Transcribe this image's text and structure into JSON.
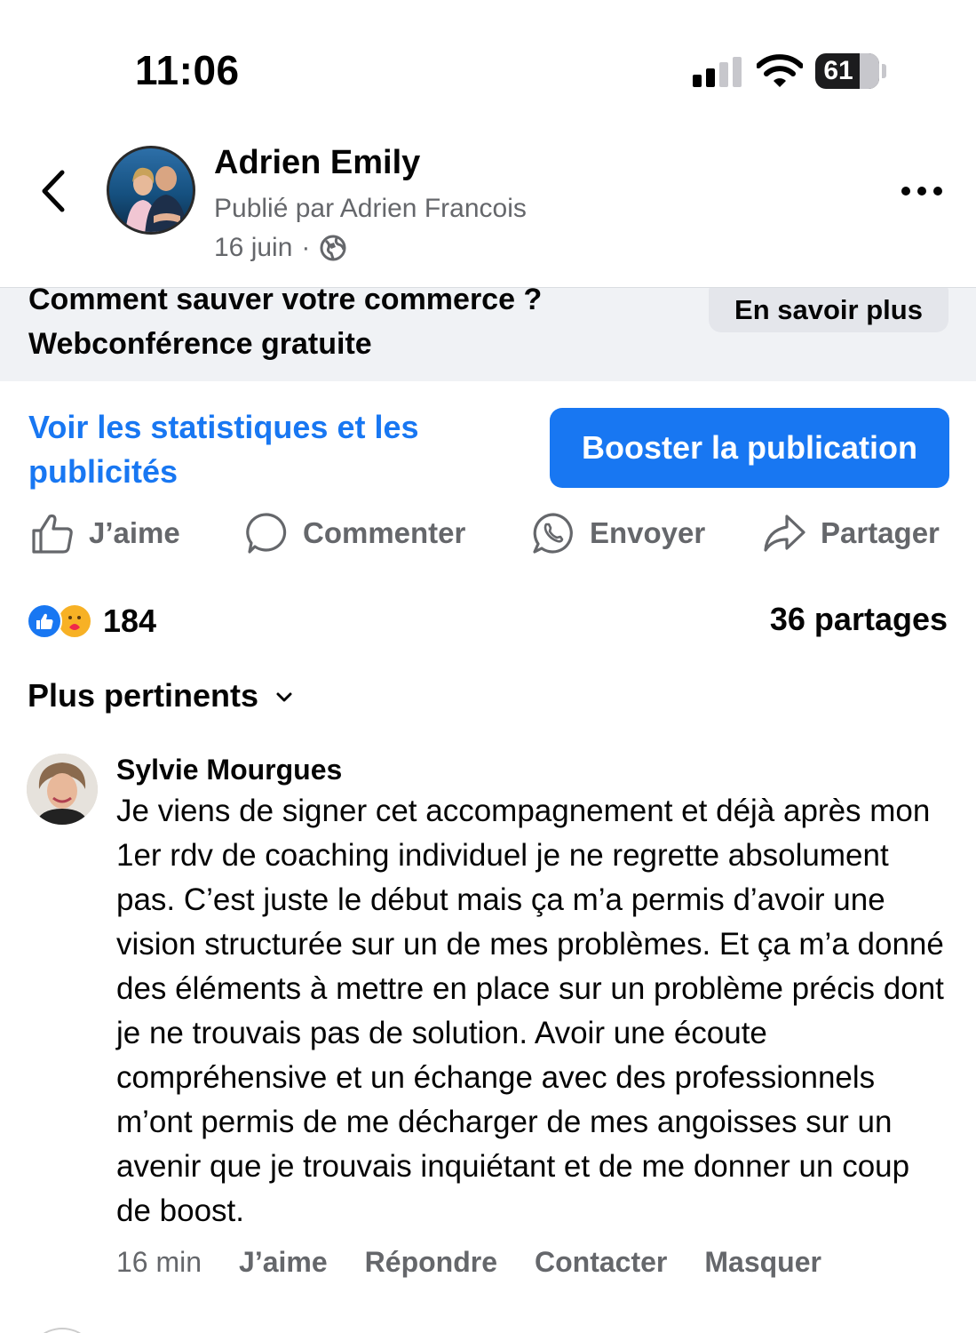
{
  "status_bar": {
    "time": "11:06",
    "battery": "61",
    "battery_level": 0.61
  },
  "post": {
    "author": "Adrien Emily",
    "posted_by": "Publié par Adrien Francois",
    "date": "16 juin",
    "separator": "·",
    "privacy_icon": "globe-icon"
  },
  "link_card": {
    "title_line_1": "Comment sauver votre commerce ?",
    "title_line_2": "Webconférence gratuite",
    "cta": "En savoir plus"
  },
  "stats_link": "Voir les statistiques et les publicités",
  "boost_button": "Booster la publication",
  "actions": {
    "like": "J’aime",
    "comment": "Commenter",
    "send": "Envoyer",
    "share": "Partager"
  },
  "reactions": {
    "count": "184",
    "shares": "36 partages",
    "types": [
      "like",
      "care"
    ]
  },
  "sort": {
    "label": "Plus pertinents"
  },
  "comment": {
    "author": "Sylvie Mourgues",
    "text": "Je viens de signer cet accompagnement et déjà après mon 1er rdv de coaching individuel je ne regrette absolument pas. C’est juste le début mais ça m’a permis d’avoir une vision structurée sur un de mes problèmes. Et ça m’a donné des éléments à mettre en place sur un problème précis dont je ne trouvais pas de solution. Avoir une écoute compréhensive et un échange avec des professionnels m’ont permis de me décharger de mes angoisses sur un avenir que je trouvais inquiétant et de me donner un coup de boost.",
    "time": "16 min",
    "like": "J’aime",
    "reply": "Répondre",
    "contact": "Contacter",
    "hide": "Masquer"
  },
  "colors": {
    "accent": "#1877f2",
    "secondary_text": "#65676b",
    "card_background": "#f0f2f5"
  }
}
